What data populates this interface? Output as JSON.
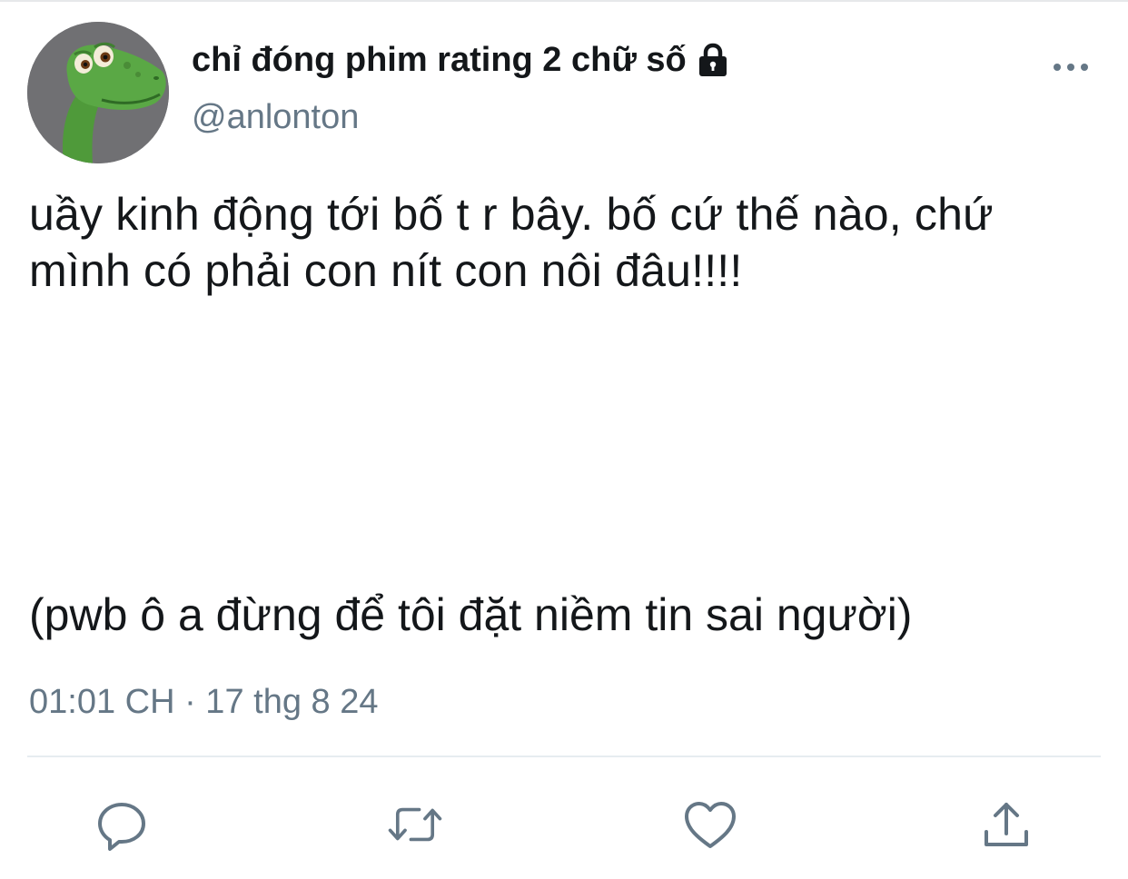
{
  "tweet": {
    "display_name": "chỉ đóng phim rating 2 chữ số",
    "handle": "@anlonton",
    "text_line_1": "uầy kinh động tới bố t r bây. bố cứ thế nào, chứ\nmình có phải con nít con nôi đâu!!!!",
    "text_line_2": "(pwb ô a đừng để tôi đặt niềm tin sai người)",
    "timestamp": "01:01 CH · 17 thg 8 24"
  },
  "icons": {
    "lock": "lock-icon",
    "more": "more-icon",
    "reply": "reply-icon",
    "retweet": "retweet-icon",
    "like": "heart-icon",
    "share": "share-icon"
  },
  "colors": {
    "text": "#14171a",
    "secondary": "#657786",
    "icon": "#657786",
    "divider": "#e6ecf0"
  }
}
